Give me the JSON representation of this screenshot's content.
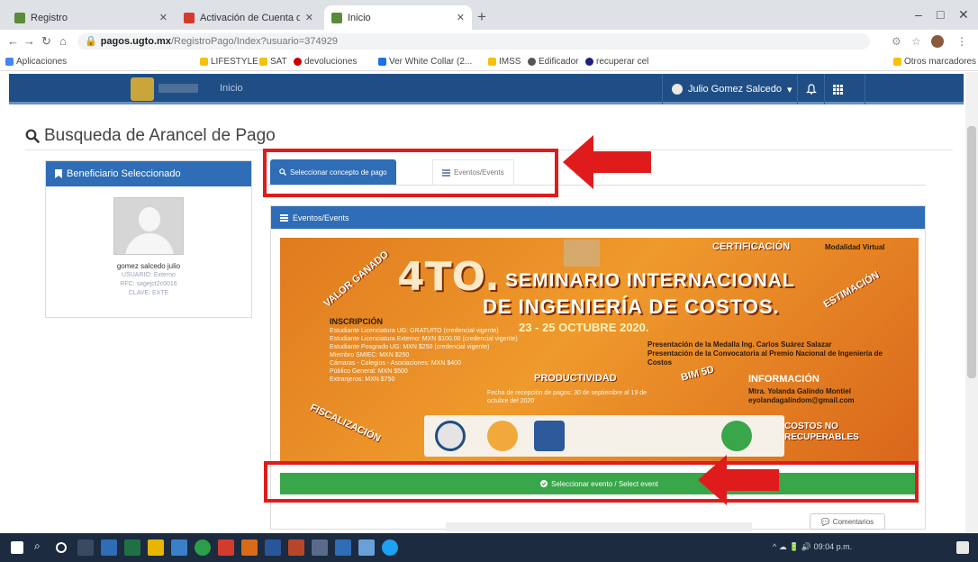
{
  "browser": {
    "tabs": [
      {
        "title": "Registro",
        "favicon_color": "#5b8a3a"
      },
      {
        "title": "Activación de Cuenta de Estudiante",
        "favicon_color": "#d33b2c"
      },
      {
        "title": "Inicio",
        "favicon_color": "#5b8a3a"
      }
    ],
    "url_host": "pagos.ugto.mx",
    "url_path": "/RegistroPago/Index?usuario=374929",
    "bookmarks": [
      {
        "label": "Aplicaciones",
        "color": "#4285f4"
      },
      {
        "label": "LIFESTYLE",
        "color": "#f4c20d"
      },
      {
        "label": "SAT",
        "color": "#f4c20d"
      },
      {
        "label": "devoluciones",
        "color": "#cc0000"
      },
      {
        "label": "Ver White Collar (2...",
        "color": "#1a73e8"
      },
      {
        "label": "IMSS",
        "color": "#f4c20d"
      },
      {
        "label": "Edificador",
        "color": "#555555"
      },
      {
        "label": "recuperar cel",
        "color": "#1a237e"
      },
      {
        "label": "Otros marcadores",
        "color": "#f4c20d"
      }
    ]
  },
  "site_nav": {
    "link": "Inicio",
    "user": "Julio Gomez Salcedo",
    "user_caret": "▾"
  },
  "page": {
    "title": "Busqueda de Arancel de Pago"
  },
  "beneficiary": {
    "header": "Beneficiario Seleccionado",
    "name": "gomez salcedo julio",
    "lines": [
      "USUARIO: Externo",
      "RFC: sagejct2c0016",
      "CLAVE: EXTE"
    ]
  },
  "content_tabs": {
    "active": "Seleccionar concepto de pago",
    "inactive": "Eventos/Events"
  },
  "events_panel": {
    "header": "Eventos/Events",
    "poster": {
      "edition": "4TO.",
      "title_line1": "SEMINARIO INTERNACIONAL",
      "title_line2": "DE INGENIERÍA DE COSTOS.",
      "dates": "23 - 25 OCTUBRE 2020.",
      "modality": "Modalidad Virtual",
      "tags": [
        "CERTIFICACIÓN",
        "VALOR GANADO",
        "ESTIMACIÓN",
        "PRODUCTIVIDAD",
        "BIM 5D",
        "FISCALIZACIÓN",
        "COSTOS NO RECUPERABLES"
      ],
      "registration_title": "INSCRIPCIÓN",
      "registration_lines": [
        "Estudiante Licenciatura UG: GRATUITO (credencial vigente)",
        "Estudiante Licenciatura Externo: MXN $100.00 (credencial vigente)",
        "Estudiante Posgrado UG: MXN $250 (credencial vigente)",
        "Miembro SMIEC: MXN $250",
        "Cámaras - Colegios - Asociaciones: MXN $400",
        "Público General: MXN $500",
        "Extranjeros: MXN $750"
      ],
      "payment_note": "Fecha de recepción de pagos: 30 de septiembre al 19 de octubre del 2020",
      "presentation_lines": [
        "Presentación de la Medalla Ing. Carlos Suárez Salazar",
        "Presentación de la Convocatoria al Premio Nacional de Ingeniería de Costos"
      ],
      "info_title": "INFORMACIÓN",
      "info_lines": [
        "Mtra. Yolanda Galindo Montiel",
        "eyolandagalindom@gmail.com"
      ]
    },
    "select_button": "Seleccionar evento / Select event"
  },
  "comment_button": "Comentarios",
  "taskbar": {
    "clock": "09:04 p.m."
  },
  "colors": {
    "nav_blue": "#1f4e86",
    "panel_blue": "#2f6db6",
    "button_green": "#3aa64a",
    "highlight_red": "#e01b1b"
  }
}
